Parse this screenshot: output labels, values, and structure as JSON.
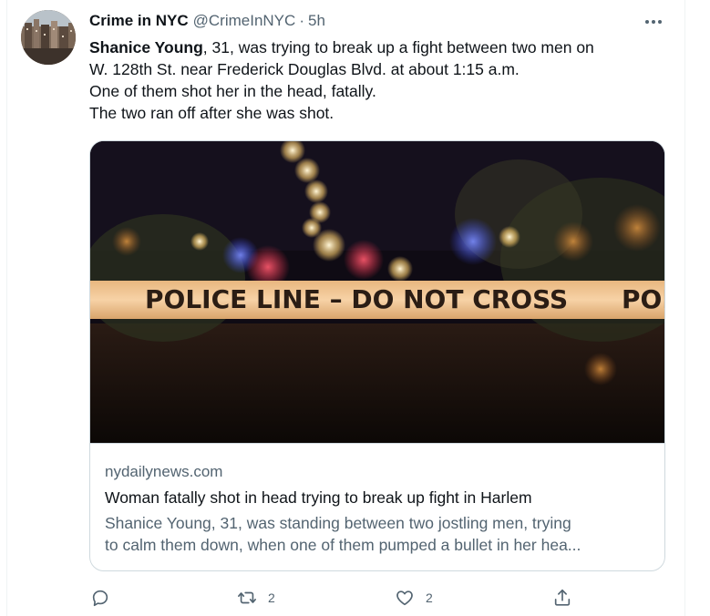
{
  "tweet": {
    "author_name": "Crime in NYC",
    "handle": "@CrimeInNYC",
    "separator": "·",
    "time": "5h",
    "text_lines": [
      {
        "bold": "Shanice Young",
        "rest": ", 31, was trying to break up a fight between two men on"
      },
      {
        "text": "W. 128th St. near Frederick Douglas Blvd. at about 1:15 a.m."
      },
      {
        "text": "One of them shot her in the head, fatally."
      },
      {
        "text": "The two ran off after she was shot."
      }
    ]
  },
  "card": {
    "image_tape_text": "POLICE LINE – DO NOT CROSS",
    "image_tape_text_2": "POLI",
    "domain": "nydailynews.com",
    "title": "Woman fatally shot in head trying to break up fight in Harlem",
    "description_lines": [
      "Shanice Young, 31, was standing between two jostling men, trying",
      "to calm them down, when one of them pumped a bullet in her hea..."
    ]
  },
  "actions": {
    "reply_count": "",
    "retweet_count": "2",
    "like_count": "2"
  },
  "icons": {
    "more": "more-options-icon",
    "reply": "reply-icon",
    "retweet": "retweet-icon",
    "like": "like-icon",
    "share": "share-icon"
  },
  "colors": {
    "text_primary": "#0f1419",
    "text_secondary": "#536471",
    "border": "#cfd9de",
    "tape": "#f2c18e"
  }
}
